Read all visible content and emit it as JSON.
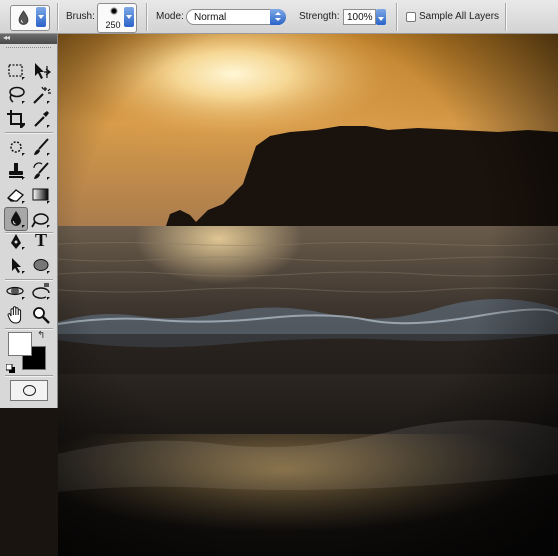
{
  "options_bar": {
    "tool_preset_icon": "blur-drop-icon",
    "brush_label": "Brush:",
    "brush_size": "250",
    "mode_label": "Mode:",
    "mode_value": "Normal",
    "strength_label": "Strength:",
    "strength_value": "100%",
    "sample_all_layers_label": "Sample All Layers",
    "sample_all_layers_checked": false
  },
  "toolbox": {
    "header_glyph": "◂◂",
    "tools": [
      "rectangular-marquee-icon",
      "move-icon",
      "lasso-icon",
      "magic-wand-icon",
      "crop-icon",
      "eyedropper-icon",
      "spot-healing-icon",
      "brush-icon",
      "clone-stamp-icon",
      "history-brush-icon",
      "eraser-icon",
      "gradient-icon",
      "blur-icon",
      "dodge-icon",
      "pen-icon",
      "type-icon",
      "path-selection-icon",
      "ellipse-icon",
      "3d-rotate-icon",
      "3d-orbit-icon",
      "hand-icon",
      "zoom-icon"
    ],
    "active_tool": "blur-icon",
    "type_tool_glyph": "T",
    "foreground_color": "#ffffff",
    "background_color": "#000000",
    "swap_glyph": "↰"
  },
  "colors": {
    "accent": "#2a64c9",
    "sky_top": "#c98a2a",
    "sun": "#fff3c6",
    "sea": "#2b2622"
  }
}
